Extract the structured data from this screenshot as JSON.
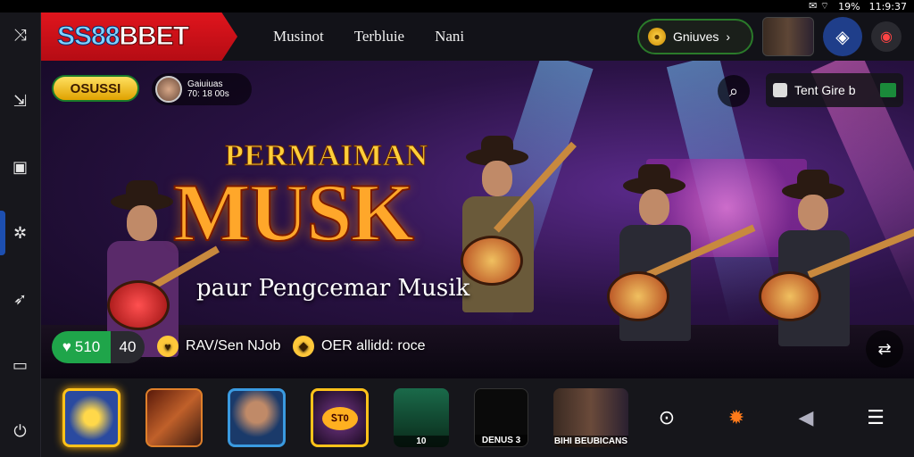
{
  "status_bar": {
    "wifi": "◠",
    "signal": "19%",
    "time": "11:9:37"
  },
  "app": {
    "logo_part1": "SS88",
    "logo_part2": "BBET"
  },
  "nav": {
    "items": [
      "Musinot",
      "Terbluie",
      "Nani"
    ]
  },
  "header": {
    "balance_label": "Gniuves",
    "balance_arrow": "›"
  },
  "banner": {
    "promo_badge": "OSUSSI",
    "user_line1": "Gaiuiuas",
    "user_line2": "70: 18 00s",
    "title_line1": "PERMAIMAN",
    "title_line2": "MUSK",
    "subtitle": "paur Pengcemar Musik",
    "find_label": "Tent Gire b",
    "stat_value": "510",
    "stat_extra": "40",
    "info1_label": "RAV/Sen NJob",
    "info2_label": "OER allidd: roce"
  },
  "games": [
    {
      "label": ""
    },
    {
      "label": ""
    },
    {
      "label": ""
    },
    {
      "label": "",
      "badge": "ᏚT0"
    },
    {
      "label": "10"
    },
    {
      "label": "DENUS 3"
    },
    {
      "label": "BIHI BEUBICANS"
    }
  ],
  "icons": {
    "sidebar": [
      "shuffle-icon",
      "login-icon",
      "briefcase-icon",
      "settings-icon",
      "rocket-icon",
      "tv-icon",
      "power-icon"
    ],
    "bottom": [
      "support-icon",
      "sun-icon",
      "speaker-icon",
      "menu-icon"
    ]
  },
  "colors": {
    "brand_red": "#e0151d",
    "accent_blue": "#1f3e8a",
    "accent_green": "#1fa54a",
    "gold": "#ffc21a"
  }
}
